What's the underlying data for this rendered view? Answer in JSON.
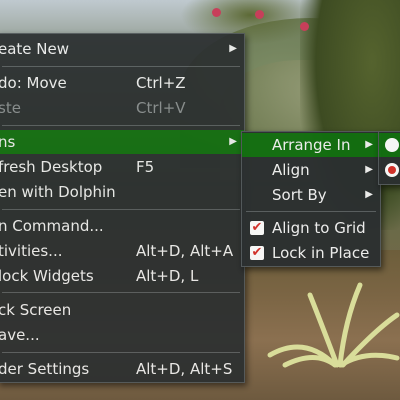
{
  "main_menu": {
    "items": [
      {
        "label": "eate New"
      },
      {
        "label": "do: Move",
        "shortcut": "Ctrl+Z"
      },
      {
        "label": "ste",
        "shortcut": "Ctrl+V"
      },
      {
        "label": "ns"
      },
      {
        "label": "fresh Desktop",
        "shortcut": "F5"
      },
      {
        "label": "en with Dolphin"
      },
      {
        "label": "n Command..."
      },
      {
        "label": "tivities...",
        "shortcut": "Alt+D, Alt+A"
      },
      {
        "label": "lock Widgets",
        "shortcut": "Alt+D, L"
      },
      {
        "label": "ck Screen"
      },
      {
        "label": "ave..."
      },
      {
        "label": "der Settings",
        "shortcut": "Alt+D, Alt+S"
      }
    ]
  },
  "icons_submenu": {
    "items": [
      {
        "label": "Arrange In"
      },
      {
        "label": "Align"
      },
      {
        "label": "Sort By"
      },
      {
        "label": "Align to Grid",
        "checked": true
      },
      {
        "label": "Lock in Place",
        "checked": true
      }
    ]
  },
  "arrange_submenu": {
    "options": [
      {
        "selected": false
      },
      {
        "selected": true
      }
    ]
  },
  "colors": {
    "menu_bg": "#2b2f30",
    "highlight": "#126f10",
    "check_mark": "#d6302a"
  }
}
